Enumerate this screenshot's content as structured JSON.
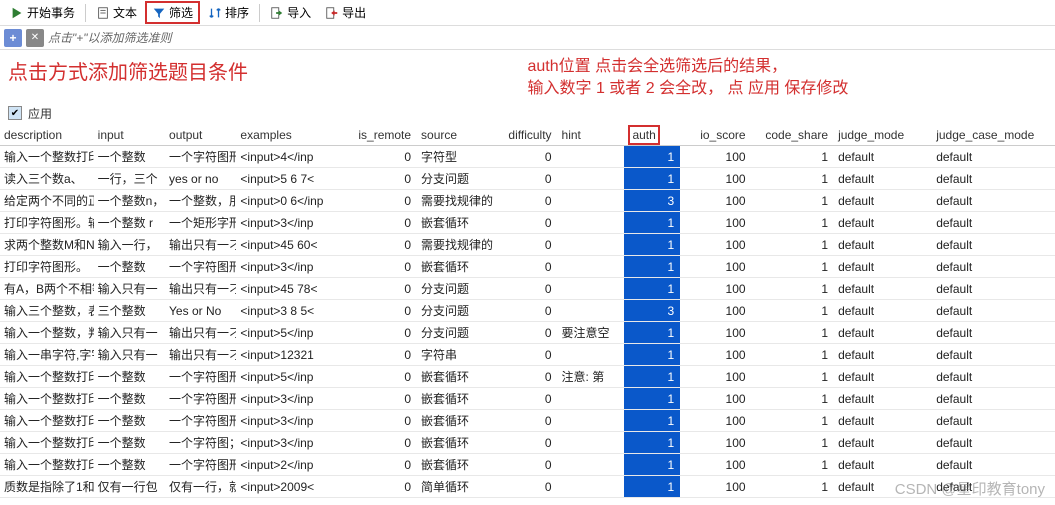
{
  "toolbar": {
    "start": "开始事务",
    "text": "文本",
    "filter": "筛选",
    "sort": "排序",
    "import": "导入",
    "export": "导出"
  },
  "filterbar": {
    "hint": "点击\"+\"以添加筛选准则"
  },
  "annotations": {
    "left": "点击方式添加筛选题目条件",
    "right1": "auth位置 点击会全选筛选后的结果，",
    "right2": "输入数字 1  或者 2 会全改， 点 应用 保存修改"
  },
  "apply": {
    "label": "应用"
  },
  "columns": {
    "description": "description",
    "input": "input",
    "output": "output",
    "examples": "examples",
    "is_remote": "is_remote",
    "source": "source",
    "difficulty": "difficulty",
    "hint": "hint",
    "auth": "auth",
    "io_score": "io_score",
    "code_share": "code_share",
    "judge_mode": "judge_mode",
    "judge_case_mode": "judge_case_mode"
  },
  "rows": [
    {
      "description": "输入一个整数打印",
      "input": "一个整数",
      "output": "一个字符图刑",
      "examples": "<input>4</inp",
      "is_remote": "0",
      "source": "字符型",
      "difficulty": "0",
      "hint": "",
      "auth": "1",
      "io_score": "100",
      "code_share": "1",
      "judge_mode": "default",
      "judge_case_mode": "default"
    },
    {
      "description": "读入三个数a、",
      "input": "一行，三个",
      "output": "yes or no",
      "examples": "<input>5 6 7<",
      "is_remote": "0",
      "source": "分支问题",
      "difficulty": "0",
      "hint": "",
      "auth": "1",
      "io_score": "100",
      "code_share": "1",
      "judge_mode": "default",
      "judge_case_mode": "default"
    },
    {
      "description": "给定两个不同的正",
      "input": "一个整数n，",
      "output": "一个整数，刖",
      "examples": "<input>0 6</inp",
      "is_remote": "0",
      "source": "需要找规律的",
      "difficulty": "0",
      "hint": "",
      "auth": "3",
      "io_score": "100",
      "code_share": "1",
      "judge_mode": "default",
      "judge_case_mode": "default"
    },
    {
      "description": "打印字符图形。输",
      "input": "一个整数 r",
      "output": "一个矩形字刑",
      "examples": "<input>3</inp",
      "is_remote": "0",
      "source": "嵌套循环",
      "difficulty": "0",
      "hint": "",
      "auth": "1",
      "io_score": "100",
      "code_share": "1",
      "judge_mode": "default",
      "judge_case_mode": "default"
    },
    {
      "description": "求两个整数M和N",
      "input": "输入一行，",
      "output": "输出只有一刁",
      "examples": "<input>45 60<",
      "is_remote": "0",
      "source": "需要找规律的",
      "difficulty": "0",
      "hint": "",
      "auth": "1",
      "io_score": "100",
      "code_share": "1",
      "judge_mode": "default",
      "judge_case_mode": "default"
    },
    {
      "description": "打印字符图形。",
      "input": "一个整数",
      "output": "一个字符图刑",
      "examples": "<input>3</inp",
      "is_remote": "0",
      "source": "嵌套循环",
      "difficulty": "0",
      "hint": "",
      "auth": "1",
      "io_score": "100",
      "code_share": "1",
      "judge_mode": "default",
      "judge_case_mode": "default"
    },
    {
      "description": "有A，B两个不相等",
      "input": "输入只有一",
      "output": "输出只有一刁",
      "examples": "<input>45 78<",
      "is_remote": "0",
      "source": "分支问题",
      "difficulty": "0",
      "hint": "",
      "auth": "1",
      "io_score": "100",
      "code_share": "1",
      "judge_mode": "default",
      "judge_case_mode": "default"
    },
    {
      "description": "输入三个整数，表",
      "input": "三个整数",
      "output": "Yes or No",
      "examples": "<input>3 8 5<",
      "is_remote": "0",
      "source": "分支问题",
      "difficulty": "0",
      "hint": "",
      "auth": "3",
      "io_score": "100",
      "code_share": "1",
      "judge_mode": "default",
      "judge_case_mode": "default"
    },
    {
      "description": "输入一个整数，判",
      "input": "输入只有一",
      "output": "输出只有一刁",
      "examples": "<input>5</inp",
      "is_remote": "0",
      "source": "分支问题",
      "difficulty": "0",
      "hint": "要注意空",
      "auth": "1",
      "io_score": "100",
      "code_share": "1",
      "judge_mode": "default",
      "judge_case_mode": "default"
    },
    {
      "description": "输入一串字符,字宇",
      "input": "输入只有一",
      "output": "输出只有一刁",
      "examples": "<input>12321",
      "is_remote": "0",
      "source": "字符串",
      "difficulty": "0",
      "hint": "",
      "auth": "1",
      "io_score": "100",
      "code_share": "1",
      "judge_mode": "default",
      "judge_case_mode": "default"
    },
    {
      "description": "输入一个整数打印",
      "input": "一个整数",
      "output": "一个字符图刑",
      "examples": "<input>5</inp",
      "is_remote": "0",
      "source": "嵌套循环",
      "difficulty": "0",
      "hint": "注意: 第",
      "auth": "1",
      "io_score": "100",
      "code_share": "1",
      "judge_mode": "default",
      "judge_case_mode": "default"
    },
    {
      "description": "输入一个整数打印",
      "input": "一个整数",
      "output": "一个字符图刑",
      "examples": "<input>3</inp",
      "is_remote": "0",
      "source": "嵌套循环",
      "difficulty": "0",
      "hint": "",
      "auth": "1",
      "io_score": "100",
      "code_share": "1",
      "judge_mode": "default",
      "judge_case_mode": "default"
    },
    {
      "description": "输入一个整数打印",
      "input": "一个整数",
      "output": "一个字符图刑",
      "examples": "<input>3</inp",
      "is_remote": "0",
      "source": "嵌套循环",
      "difficulty": "0",
      "hint": "",
      "auth": "1",
      "io_score": "100",
      "code_share": "1",
      "judge_mode": "default",
      "judge_case_mode": "default"
    },
    {
      "description": "输入一个整数打印",
      "input": "一个整数",
      "output": "一个字符图；",
      "examples": "<input>3</inp",
      "is_remote": "0",
      "source": "嵌套循环",
      "difficulty": "0",
      "hint": "",
      "auth": "1",
      "io_score": "100",
      "code_share": "1",
      "judge_mode": "default",
      "judge_case_mode": "default"
    },
    {
      "description": "输入一个整数打印",
      "input": "一个整数",
      "output": "一个字符图刑",
      "examples": "<input>2</inp",
      "is_remote": "0",
      "source": "嵌套循环",
      "difficulty": "0",
      "hint": "",
      "auth": "1",
      "io_score": "100",
      "code_share": "1",
      "judge_mode": "default",
      "judge_case_mode": "default"
    },
    {
      "description": "质数是指除了1和",
      "input": "仅有一行包",
      "output": "仅有一行，就",
      "examples": "<input>2009<",
      "is_remote": "0",
      "source": "简单循环",
      "difficulty": "0",
      "hint": "",
      "auth": "1",
      "io_score": "100",
      "code_share": "1",
      "judge_mode": "default",
      "judge_case_mode": "default"
    }
  ],
  "watermark": "CSDN @星印教育tony"
}
